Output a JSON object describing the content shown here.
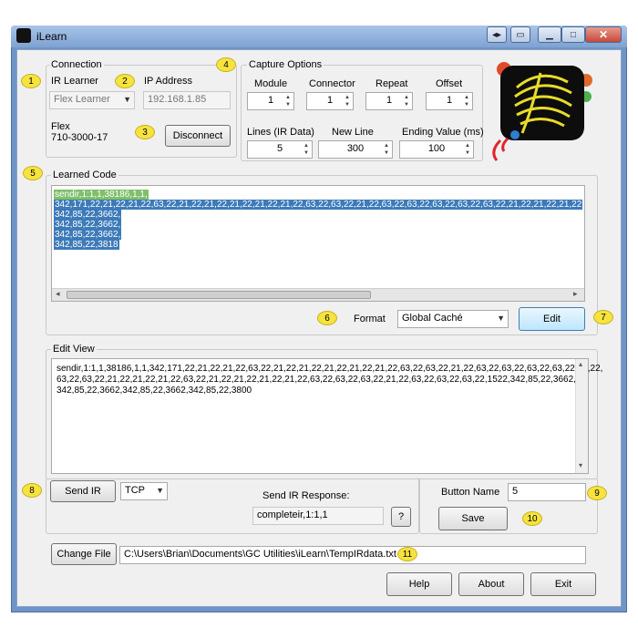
{
  "window": {
    "title": "iLearn",
    "buttons": [
      "◂▸",
      "▭",
      "▁",
      "□",
      "✕"
    ]
  },
  "connection": {
    "legend": "Connection",
    "ir_learner_label": "IR Learner",
    "ir_learner_value": "Flex Learner",
    "ip_label": "IP Address",
    "ip_value": "192.168.1.85",
    "device_name": "Flex",
    "device_model": "710-3000-17",
    "disconnect_label": "Disconnect"
  },
  "capture": {
    "legend": "Capture Options",
    "module_label": "Module",
    "module_value": "1",
    "connector_label": "Connector",
    "connector_value": "1",
    "repeat_label": "Repeat",
    "repeat_value": "1",
    "offset_label": "Offset",
    "offset_value": "1",
    "lines_label": "Lines (IR Data)",
    "lines_value": "5",
    "newline_label": "New Line",
    "newline_value": "300",
    "ending_label": "Ending Value (ms)",
    "ending_value": "100"
  },
  "learned": {
    "legend": "Learned Code",
    "lines": [
      "sendir,1:1,1,38186,1,1,",
      "342,171,22,21,22,21,22,63,22,21,22,21,22,21,22,21,22,21,22,63,22,63,22,21,22,63,22,63,22,63,22,63,22,63,22,21,22,21,22,21,22",
      "342,85,22,3662,",
      "342,85,22,3662,",
      "342,85,22,3662,",
      "342,85,22,3818"
    ],
    "format_label": "Format",
    "format_value": "Global Caché",
    "edit_label": "Edit"
  },
  "edit_view": {
    "legend": "Edit View",
    "lines": [
      "sendir,1:1,1,38186,1,1,342,171,22,21,22,21,22,63,22,21,22,21,22,21,22,21,22,21,22,63,22,63,22,21,22,63,22,63,22,63,22,63,22,63,22,",
      "63,22,63,22,21,22,21,22,21,22,63,22,21,22,21,22,21,22,21,22,63,22,63,22,63,22,21,22,63,22,63,22,63,22,1522,342,85,22,3662,",
      "342,85,22,3662,342,85,22,3662,342,85,22,3800"
    ]
  },
  "send": {
    "send_label": "Send IR",
    "protocol_value": "TCP",
    "response_label": "Send IR Response:",
    "response_value": "completeir,1:1,1",
    "help_q": "?"
  },
  "button_name": {
    "label": "Button Name",
    "value": "5",
    "save_label": "Save"
  },
  "file": {
    "change_label": "Change File",
    "path": "C:\\Users\\Brian\\Documents\\GC Utilities\\iLearn\\TempIRdata.txt"
  },
  "footer": {
    "help": "Help",
    "about": "About",
    "exit": "Exit"
  },
  "callouts": [
    "1",
    "2",
    "3",
    "4",
    "5",
    "6",
    "7",
    "8",
    "9",
    "10",
    "11"
  ],
  "colors": {
    "selection_blue": "#3d7ab8",
    "selection_green": "#7fbf6a",
    "callout_yellow": "#f6e33f",
    "title_bar": "#7ea2d2"
  }
}
